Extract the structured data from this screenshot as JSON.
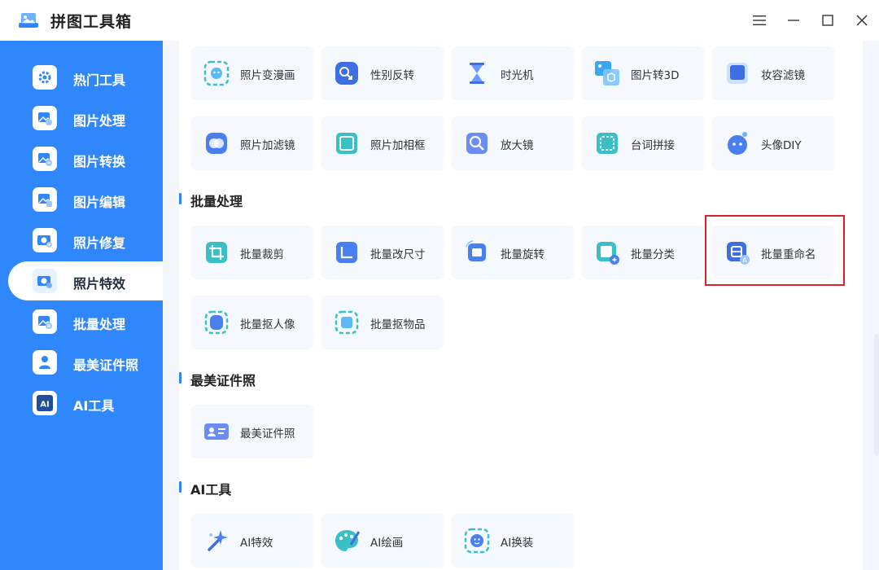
{
  "app": {
    "title": "拼图工具箱"
  },
  "sidebar": {
    "items": [
      {
        "label": "热门工具",
        "icon": "gear-icon"
      },
      {
        "label": "图片处理",
        "icon": "image-process-icon"
      },
      {
        "label": "图片转换",
        "icon": "image-convert-icon"
      },
      {
        "label": "图片编辑",
        "icon": "image-edit-icon"
      },
      {
        "label": "照片修复",
        "icon": "photo-repair-icon"
      },
      {
        "label": "照片特效",
        "icon": "photo-effect-icon"
      },
      {
        "label": "批量处理",
        "icon": "batch-icon"
      },
      {
        "label": "最美证件照",
        "icon": "id-photo-icon"
      },
      {
        "label": "AI工具",
        "icon": "ai-icon"
      }
    ],
    "active_index": 5
  },
  "sections": {
    "effects": {
      "tools": [
        {
          "label": "照片变漫画",
          "icon": "cartoon-icon"
        },
        {
          "label": "性别反转",
          "icon": "gender-swap-icon"
        },
        {
          "label": "时光机",
          "icon": "hourglass-icon"
        },
        {
          "label": "图片转3D",
          "icon": "3d-icon"
        },
        {
          "label": "妆容滤镜",
          "icon": "makeup-filter-icon"
        },
        {
          "label": "照片加滤镜",
          "icon": "filter-icon"
        },
        {
          "label": "照片加相框",
          "icon": "frame-icon"
        },
        {
          "label": "放大镜",
          "icon": "magnifier-icon"
        },
        {
          "label": "台词拼接",
          "icon": "caption-stitch-icon"
        },
        {
          "label": "头像DIY",
          "icon": "avatar-diy-icon"
        }
      ]
    },
    "batch": {
      "title": "批量处理",
      "tools": [
        {
          "label": "批量裁剪",
          "icon": "crop-icon"
        },
        {
          "label": "批量改尺寸",
          "icon": "resize-icon"
        },
        {
          "label": "批量旋转",
          "icon": "rotate-icon"
        },
        {
          "label": "批量分类",
          "icon": "classify-icon"
        },
        {
          "label": "批量重命名",
          "icon": "rename-icon"
        },
        {
          "label": "批量抠人像",
          "icon": "portrait-cutout-icon"
        },
        {
          "label": "批量抠物品",
          "icon": "object-cutout-icon"
        }
      ]
    },
    "idphoto": {
      "title": "最美证件照",
      "tools": [
        {
          "label": "最美证件照",
          "icon": "id-card-icon"
        }
      ]
    },
    "ai": {
      "title": "AI工具",
      "tools": [
        {
          "label": "AI特效",
          "icon": "magic-wand-icon"
        },
        {
          "label": "AI绘画",
          "icon": "palette-icon"
        },
        {
          "label": "AI换装",
          "icon": "face-swap-icon"
        }
      ]
    }
  },
  "colors": {
    "accent": "#2f87fb",
    "highlight": "#d9222a",
    "card": "#f5f8fd"
  }
}
